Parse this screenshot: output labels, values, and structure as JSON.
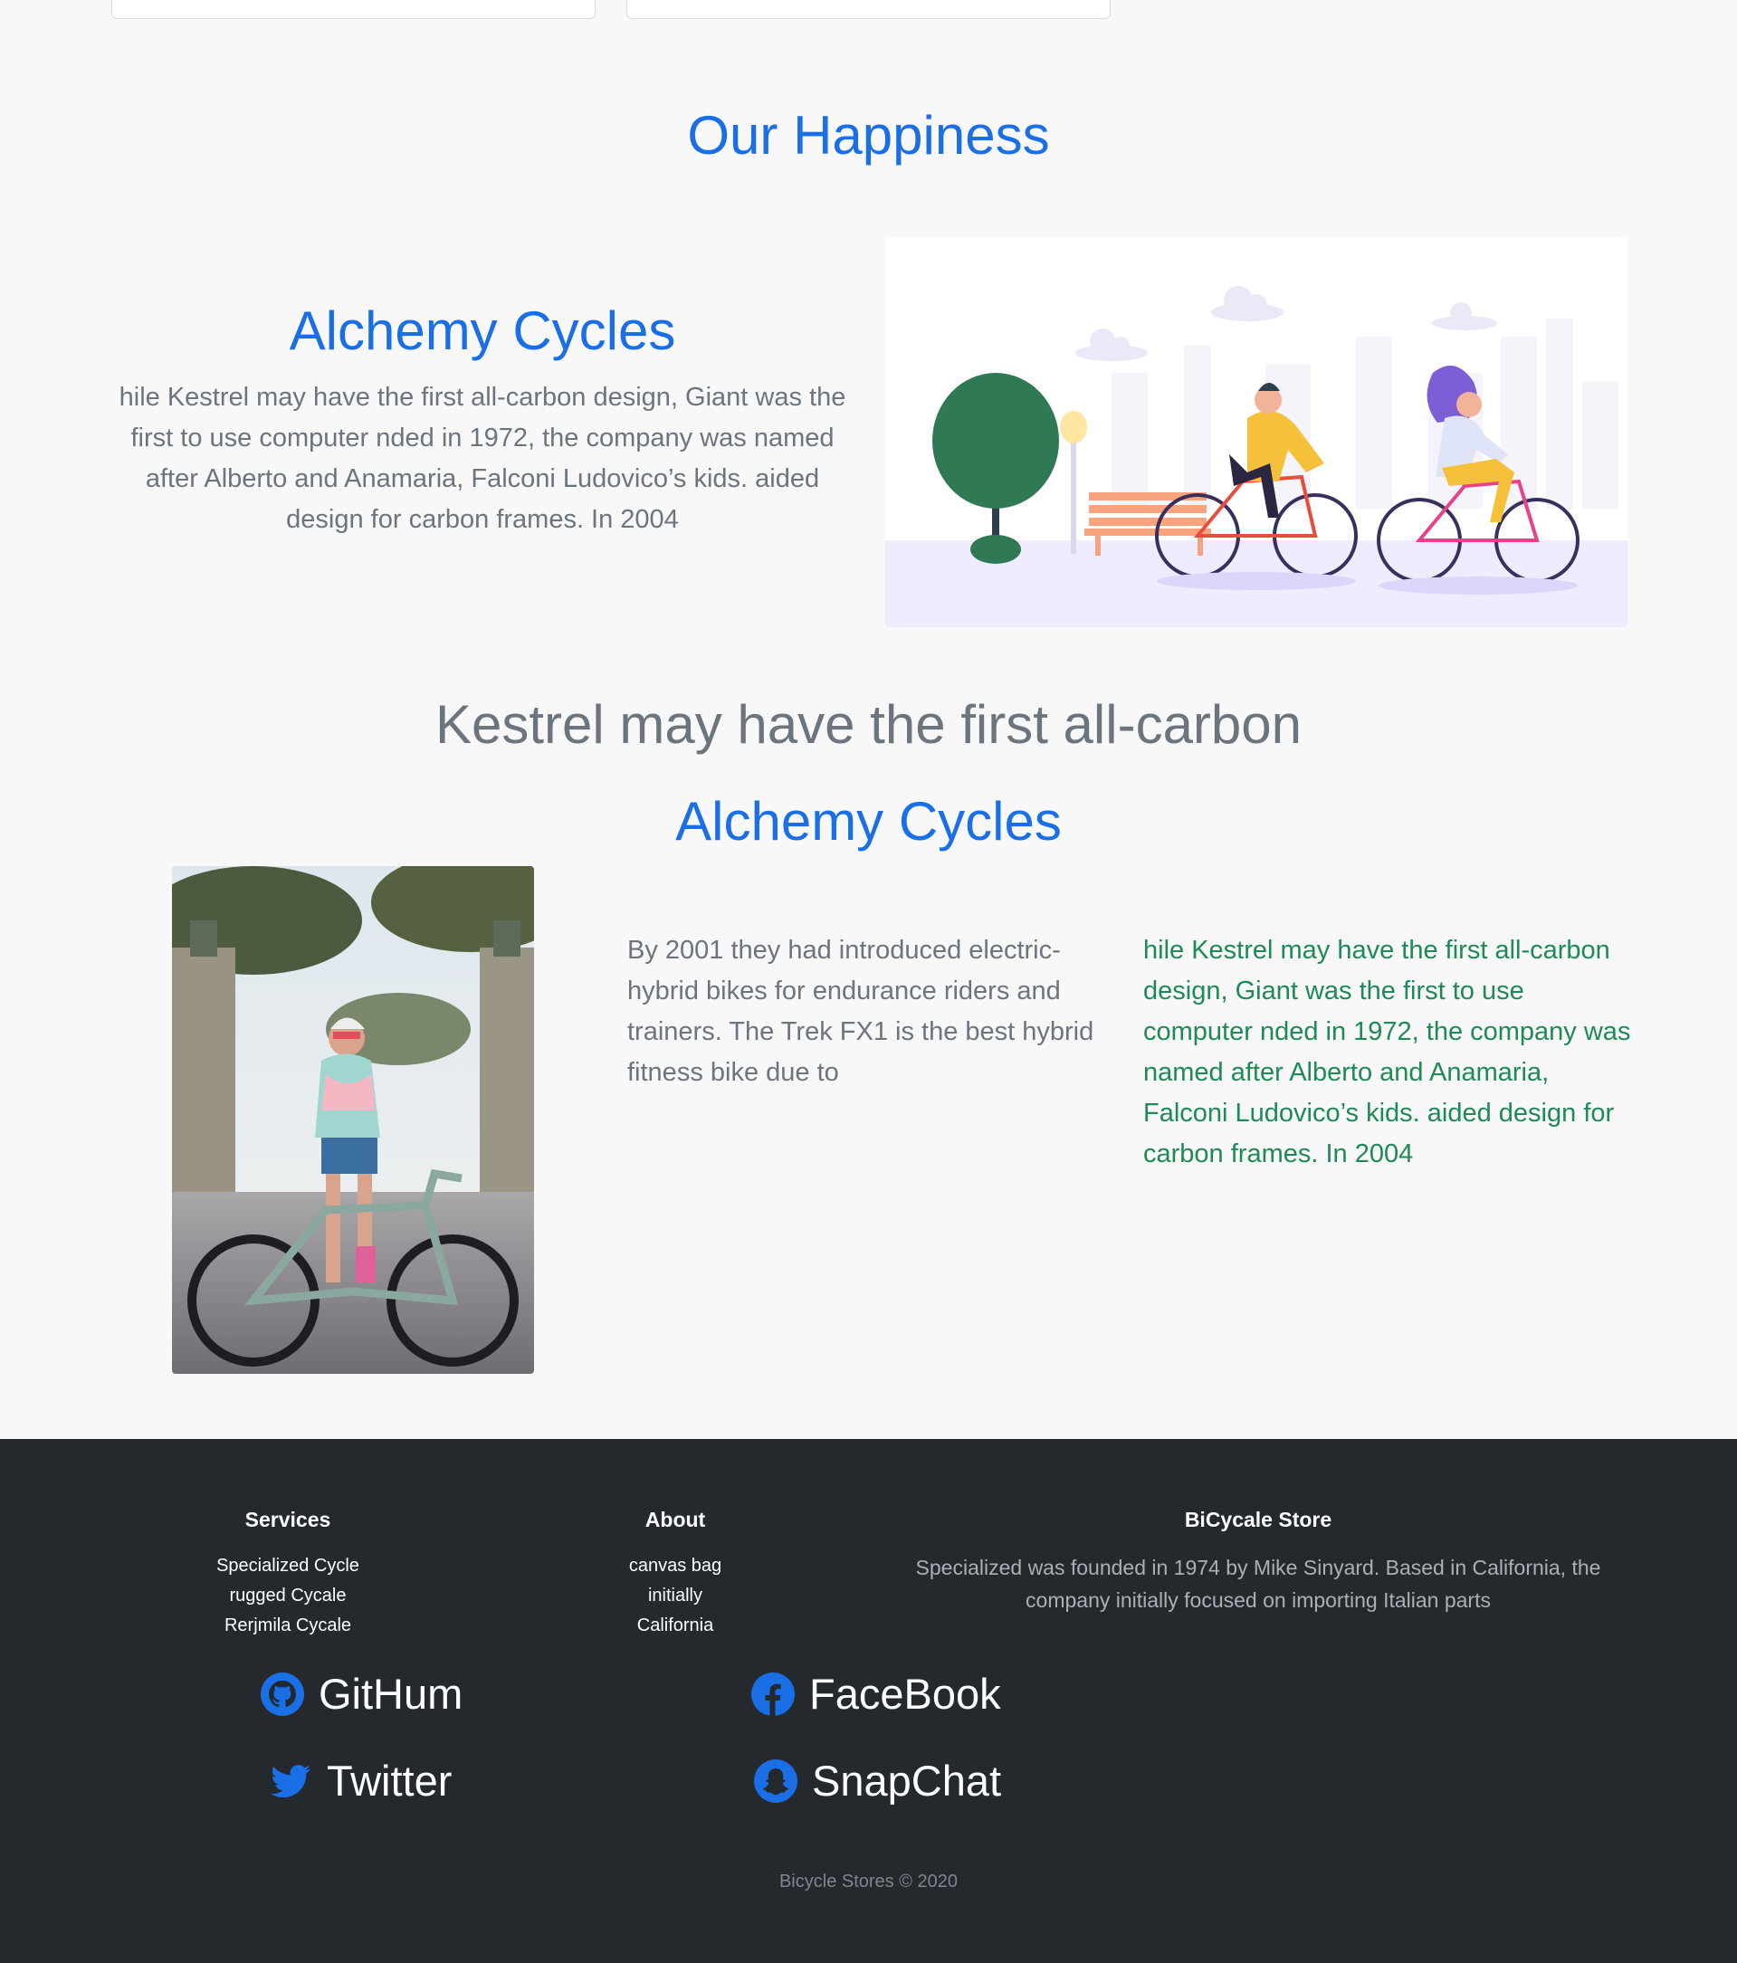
{
  "happiness": {
    "title": "Our Happiness",
    "block1": {
      "heading": "Alchemy Cycles",
      "text": "hile Kestrel may have the first all-carbon design, Giant was the first to use computer nded in 1972, the company was named after Alberto and Anamaria, Falconi Ludovico’s kids. aided design for carbon frames. In 2004"
    }
  },
  "feature": {
    "title": "Kestrel may have the first all-carbon",
    "subtitle": "Alchemy Cycles",
    "text_left": "By 2001 they had introduced electric-hybrid bikes for endurance riders and trainers. The Trek FX1 is the best hybrid fitness bike due to",
    "text_right": "hile Kestrel may have the first all-carbon design, Giant was the first to use computer nded in 1972, the company was named after Alberto and Anamaria, Falconi Ludovico’s kids. aided design for carbon frames. In 2004"
  },
  "footer": {
    "services": {
      "title": "Services",
      "items": [
        "Specialized Cycle",
        "rugged Cycale",
        "Rerjmila Cycale"
      ]
    },
    "about": {
      "title": "About",
      "items": [
        "canvas bag",
        "initially",
        "California"
      ]
    },
    "store": {
      "title": "BiCycale Store",
      "text": "Specialized was founded in 1974 by Mike Sinyard. Based in California, the company initially focused on importing Italian parts"
    },
    "social": {
      "github": "GitHum",
      "facebook": "FaceBook",
      "twitter": "Twitter",
      "snapchat": "SnapChat"
    },
    "copyright": "Bicycle Stores © 2020"
  },
  "colors": {
    "accent": "#1a6fe6",
    "muted_text": "#6c747d",
    "green_text": "#1e8a55",
    "footer_bg": "#24292d"
  }
}
